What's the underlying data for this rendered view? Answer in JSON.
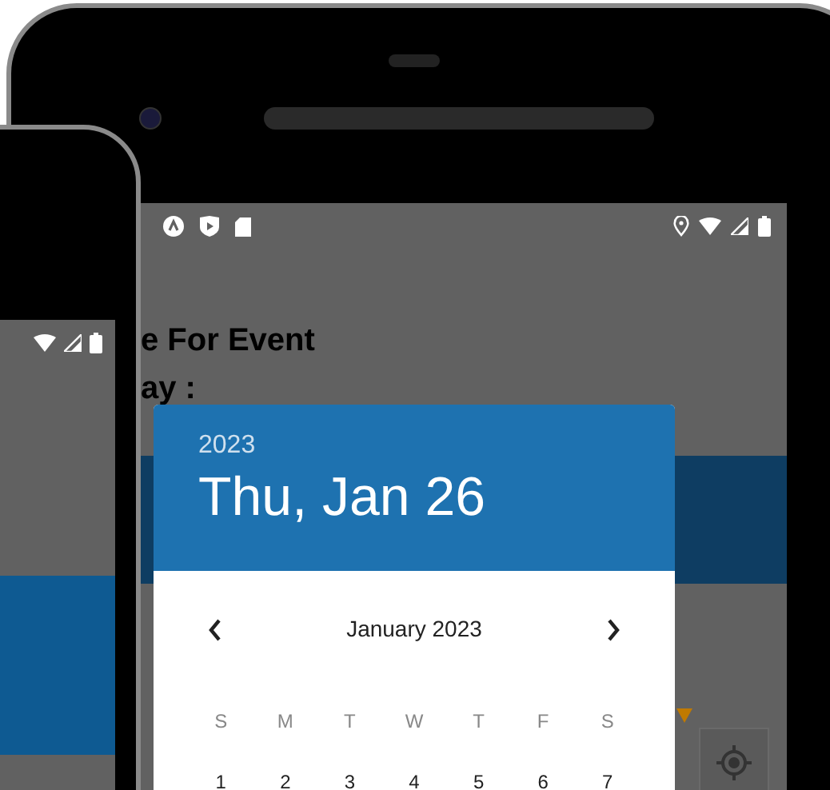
{
  "form": {
    "title_fragment": "e For Event",
    "label_fragment": "ay :"
  },
  "date_picker": {
    "year": "2023",
    "date": "Thu, Jan 26",
    "month": "January 2023",
    "weekdays": [
      "S",
      "M",
      "T",
      "W",
      "T",
      "F",
      "S"
    ],
    "days": [
      "1",
      "2",
      "3",
      "4",
      "5",
      "6",
      "7"
    ]
  }
}
